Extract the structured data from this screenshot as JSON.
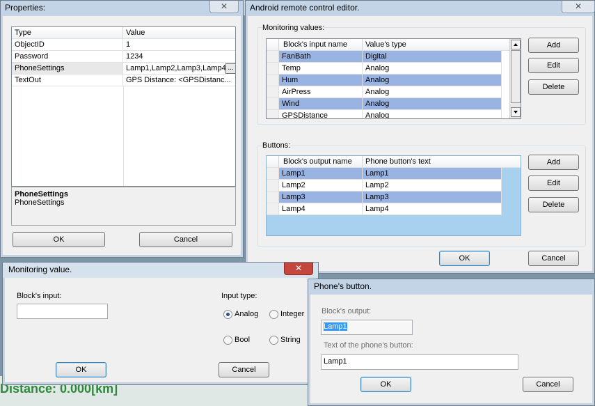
{
  "properties": {
    "title": "Properties:",
    "close": "✕",
    "columns": [
      "Type",
      "Value"
    ],
    "rows": [
      {
        "type": "ObjectID",
        "value": "1"
      },
      {
        "type": "Password",
        "value": "1234"
      },
      {
        "type": "PhoneSettings",
        "value": "Lamp1,Lamp2,Lamp3,Lamp4",
        "ellipsis": "..."
      },
      {
        "type": "TextOut",
        "value": "GPS Distance: <GPSDistanc..."
      }
    ],
    "desc_title": "PhoneSettings",
    "desc_text": "PhoneSettings",
    "ok": "OK",
    "cancel": "Cancel"
  },
  "editor": {
    "title": "Android remote control editor.",
    "close": "✕",
    "monitoring": {
      "label": "Monitoring values:",
      "columns": [
        "Block's input name",
        "Value's type"
      ],
      "rows": [
        {
          "name": "FanBath",
          "type": "Digital",
          "selected": true
        },
        {
          "name": "Temp",
          "type": "Analog",
          "selected": false
        },
        {
          "name": "Hum",
          "type": "Analog",
          "selected": true
        },
        {
          "name": "AirPress",
          "type": "Analog",
          "selected": false
        },
        {
          "name": "Wind",
          "type": "Analog",
          "selected": true
        },
        {
          "name": "GPSDistance",
          "type": "Analog",
          "selected": false
        }
      ],
      "add": "Add",
      "edit": "Edit",
      "delete": "Delete"
    },
    "buttons": {
      "label": "Buttons:",
      "columns": [
        "Block's output name",
        "Phone button's text"
      ],
      "rows": [
        {
          "name": "Lamp1",
          "text": "Lamp1",
          "selected": true
        },
        {
          "name": "Lamp2",
          "text": "Lamp2",
          "selected": false
        },
        {
          "name": "Lamp3",
          "text": "Lamp3",
          "selected": true
        },
        {
          "name": "Lamp4",
          "text": "Lamp4",
          "selected": false
        }
      ],
      "add": "Add",
      "edit": "Edit",
      "delete": "Delete"
    },
    "ok": "OK",
    "cancel": "Cancel"
  },
  "monitoring_value": {
    "title": "Monitoring value.",
    "close": "✕",
    "input_label": "Block's input:",
    "input_value": "",
    "input_type_label": "Input type:",
    "options": [
      "Analog",
      "Integer",
      "Bool",
      "String"
    ],
    "selected": "Analog",
    "ok": "OK",
    "cancel": "Cancel"
  },
  "phone_button": {
    "title": "Phone's button.",
    "output_label": "Block's output:",
    "output_value": "Lamp1",
    "text_label": "Text of the phone's button:",
    "text_value": "Lamp1",
    "ok": "OK",
    "cancel": "Cancel"
  },
  "background": {
    "text": "Distance: 0.000[km]"
  },
  "colors": {
    "selection": "#99b4e3",
    "title_bar": "#c3d4e6",
    "close_red": "#c4463c"
  }
}
